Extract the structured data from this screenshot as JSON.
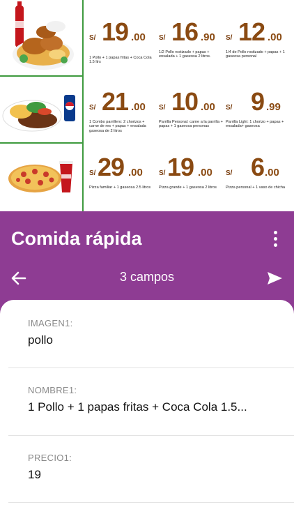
{
  "menu": {
    "rows": [
      {
        "image": "pollo-combo-image",
        "items": [
          {
            "currency": "S/",
            "integer": "19",
            "decimals": ".00",
            "description": "1 Pollo + 1 papas fritas + Coca Cola 1.5 ltrs"
          },
          {
            "currency": "S/",
            "integer": "16",
            "decimals": ".90",
            "description": "1/2 Pollo rostizado + papas + ensalada + 1 gaseosa 2 litros."
          },
          {
            "currency": "S/",
            "integer": "12",
            "decimals": ".00",
            "description": "1/4 de Pollo rostizado + papas + 1 gaseosa personal"
          }
        ]
      },
      {
        "image": "parrilla-combo-image",
        "items": [
          {
            "currency": "S/",
            "integer": "21",
            "decimals": ".00",
            "description": "1 Combo parrillero: 2 chorizos + carne de res + papas + ensalada gaseosa de 2 litros"
          },
          {
            "currency": "S/",
            "integer": "10",
            "decimals": ".00",
            "description": "Parrilla Personal: carne a la parrilla + papas + 1 gaseosa personas"
          },
          {
            "currency": "S/",
            "integer": "9",
            "decimals": ".99",
            "description": "Parrilla Light: 1 chorizo + papas + ensalada+ gaseosa"
          }
        ]
      },
      {
        "image": "pizza-combo-image",
        "items": [
          {
            "currency": "S/",
            "integer": "29",
            "decimals": ".00",
            "description": "Pizza familiar + 1 gaseosa 2.5 litros"
          },
          {
            "currency": "S/",
            "integer": "19",
            "decimals": ".00",
            "description": "Pizza grande + 1 gaseosa 2 litros"
          },
          {
            "currency": "S/",
            "integer": "6",
            "decimals": ".00",
            "description": "Pizza personal + 1 vaso de chicha"
          }
        ]
      }
    ]
  },
  "header": {
    "title": "Comida rápida",
    "fields_count": "3 campos",
    "back_icon": "arrow-left-icon",
    "send_icon": "send-icon",
    "more_icon": "more-vertical-icon",
    "color": "#8e3c93"
  },
  "form": {
    "fields": [
      {
        "label": "IMAGEN1:",
        "value": "pollo"
      },
      {
        "label": "NOMBRE1:",
        "value": "1 Pollo + 1 papas fritas + Coca Cola 1.5..."
      },
      {
        "label": "PRECIO1:",
        "value": "19"
      }
    ]
  }
}
